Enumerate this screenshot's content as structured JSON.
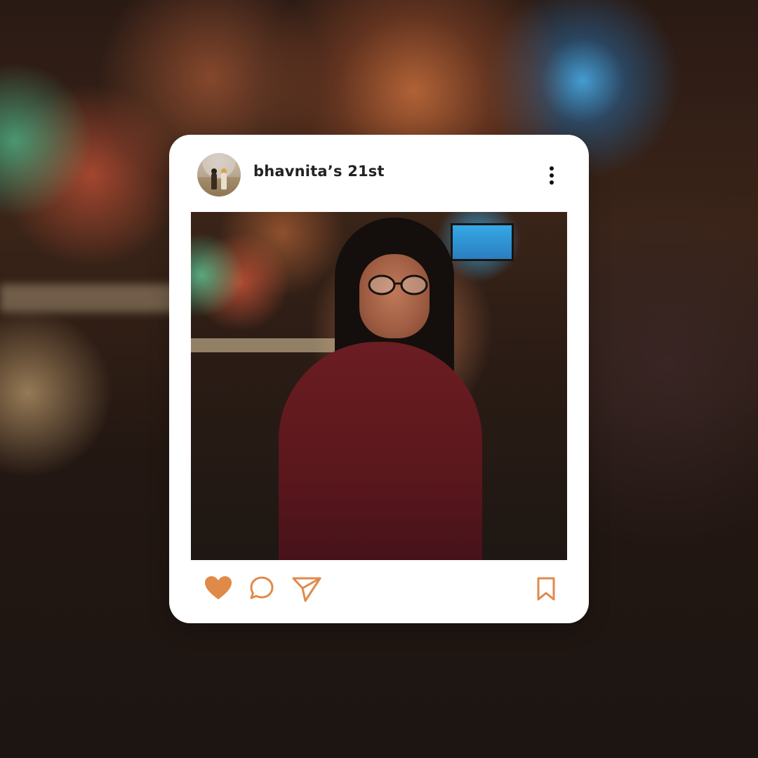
{
  "post": {
    "username": "bhavnita’s 21st",
    "liked": true,
    "accent_color": "#E08a4a"
  },
  "icons": {
    "more": "more-vertical-icon",
    "like": "heart-icon",
    "comment": "comment-icon",
    "share": "send-icon",
    "save": "bookmark-icon"
  }
}
